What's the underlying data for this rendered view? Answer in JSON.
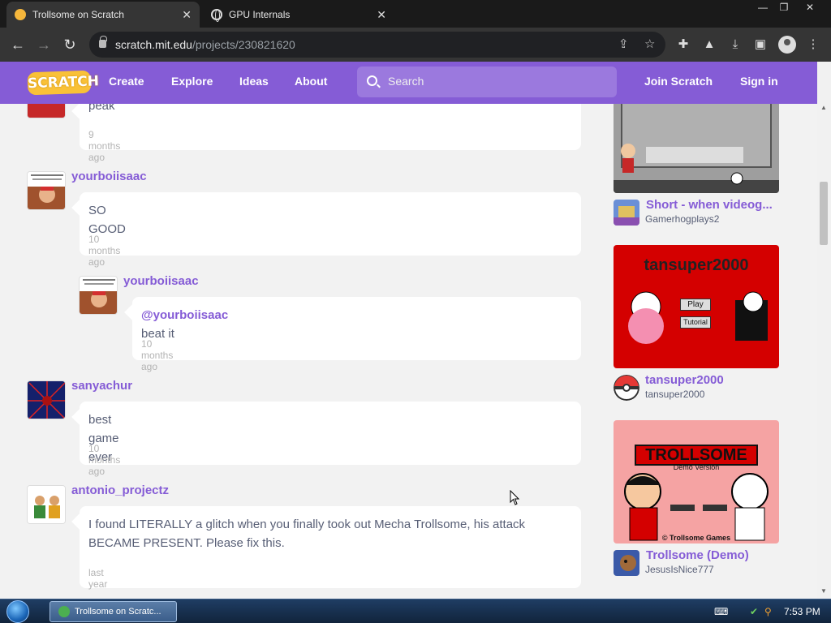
{
  "browser": {
    "tabs": [
      {
        "title": "Trollsome on Scratch",
        "active": true,
        "favicon": "scratch-favicon-icon"
      },
      {
        "title": "GPU Internals",
        "active": false,
        "favicon": "globe-icon"
      }
    ],
    "url_host": "scratch.mit.edu",
    "url_path": "/projects/230821620"
  },
  "scratch_nav": {
    "logo": "SCRATCH",
    "links": [
      "Create",
      "Explore",
      "Ideas",
      "About"
    ],
    "search_placeholder": "Search",
    "join": "Join Scratch",
    "signin": "Sign in",
    "brand_color": "#855cd6"
  },
  "comments": [
    {
      "username": "",
      "text": "peak",
      "time": "9 months ago"
    },
    {
      "username": "yourboiisaac",
      "text": "SO GOOD",
      "time": "10 months ago"
    },
    {
      "username": "yourboiisaac",
      "mention": "@yourboiisaac",
      "text": " beat it",
      "time": "10 months ago",
      "reply": true
    },
    {
      "username": "sanyachur",
      "text": "best game ever",
      "time": "10 months ago"
    },
    {
      "username": "antonio_projectz",
      "text": "I found LITERALLY a glitch when you finally took out Mecha Trollsome, his attack BECAME PRESENT. Please fix this.",
      "time": "last year"
    }
  ],
  "sidebar_projects": [
    {
      "title": "Short - when videog...",
      "owner": "Gamerhogplays2"
    },
    {
      "title": "tansuper2000",
      "owner": "tansuper2000",
      "thumb_heading": "tansuper2000",
      "thumb_buttons": [
        "Play",
        "Tutorial"
      ]
    },
    {
      "title": "Trollsome (Demo)",
      "owner": "JesusIsNice777",
      "thumb_heading": "TROLLSOME",
      "thumb_sub": "Demo Version",
      "thumb_credit": "© Trollsome Games"
    }
  ],
  "taskbar": {
    "active_item": "Trollsome on Scratc...",
    "clock": "7:53 PM"
  }
}
